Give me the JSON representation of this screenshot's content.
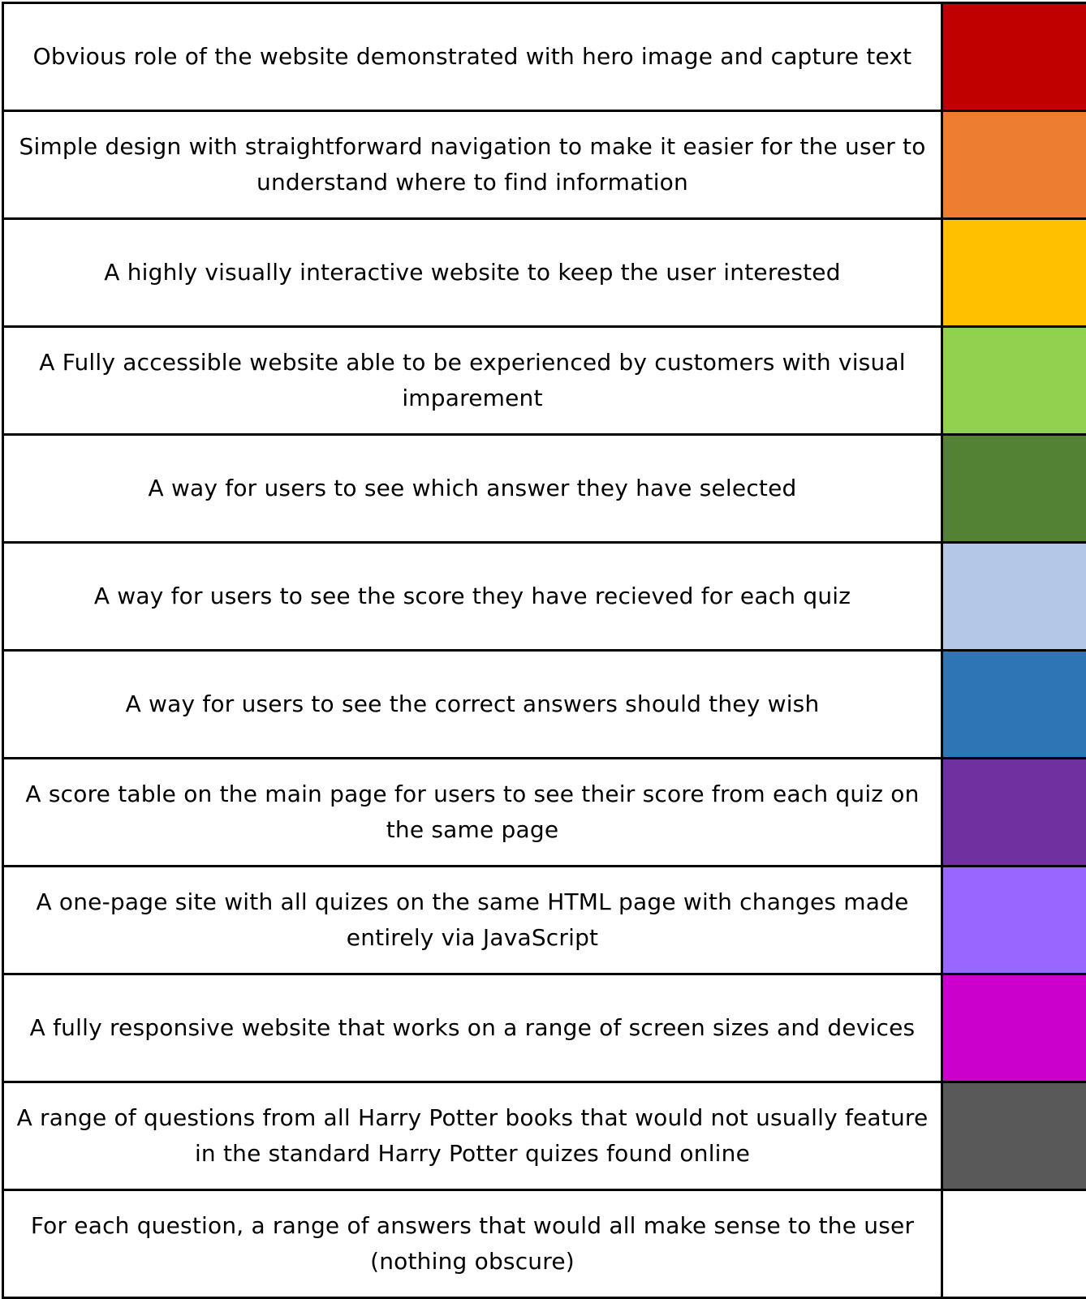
{
  "legend": {
    "rows": [
      {
        "label": "Obvious role of the website demonstrated with hero image and capture text",
        "color": "#C00000"
      },
      {
        "label": "Simple design with straightforward navigation to make it easier for the user to understand where to find information",
        "color": "#ED7D31"
      },
      {
        "label": "A highly visually interactive website to keep the user interested",
        "color": "#FFC000"
      },
      {
        "label": "A Fully accessible website able to be experienced by customers with visual imparement",
        "color": "#92D050"
      },
      {
        "label": "A way for users to see which answer they have selected",
        "color": "#548235"
      },
      {
        "label": "A way for users to see the score they have recieved for each quiz",
        "color": "#B4C7E7"
      },
      {
        "label": "A way for users to see the correct answers should they wish",
        "color": "#2E75B6"
      },
      {
        "label": "A score table on the main page for users to see their score from each quiz on the same page",
        "color": "#7030A0"
      },
      {
        "label": "A one-page site with all quizes on the same HTML page with changes made entirely via JavaScript",
        "color": "#9966FF"
      },
      {
        "label": "A fully responsive website that works on a range of screen sizes and devices",
        "color": "#CC00CC"
      },
      {
        "label": "A range of questions from all Harry Potter books that would not usually feature in the standard Harry Potter quizes found online",
        "color": "#595959"
      },
      {
        "label": "For each question, a range of answers that would all make sense to the user (nothing obscure)",
        "color": "#FFFFFF"
      }
    ]
  }
}
